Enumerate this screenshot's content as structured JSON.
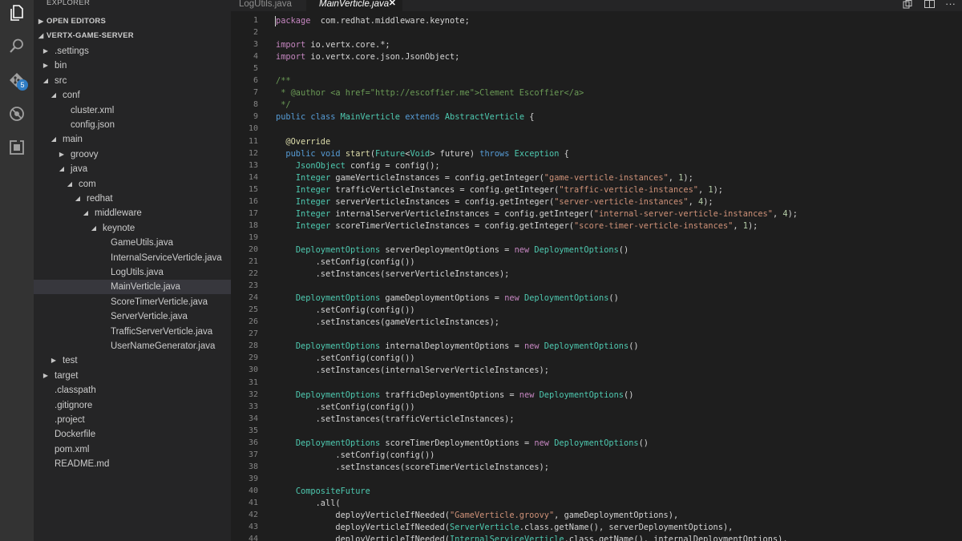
{
  "sidebar": {
    "title": "EXPLORER",
    "open_editors": "OPEN EDITORS",
    "project": "VERTX-GAME-SERVER",
    "tree": [
      {
        "label": ".settings",
        "level": 1,
        "twisty": "collapsed"
      },
      {
        "label": "bin",
        "level": 1,
        "twisty": "collapsed"
      },
      {
        "label": "src",
        "level": 1,
        "twisty": "expanded"
      },
      {
        "label": "conf",
        "level": 2,
        "twisty": "expanded"
      },
      {
        "label": "cluster.xml",
        "level": 3,
        "twisty": "none"
      },
      {
        "label": "config.json",
        "level": 3,
        "twisty": "none"
      },
      {
        "label": "main",
        "level": 2,
        "twisty": "expanded"
      },
      {
        "label": "groovy",
        "level": 3,
        "twisty": "collapsed"
      },
      {
        "label": "java",
        "level": 3,
        "twisty": "expanded"
      },
      {
        "label": "com",
        "level": 4,
        "twisty": "expanded"
      },
      {
        "label": "redhat",
        "level": 5,
        "twisty": "expanded"
      },
      {
        "label": "middleware",
        "level": 6,
        "twisty": "expanded"
      },
      {
        "label": "keynote",
        "level": 7,
        "twisty": "expanded"
      },
      {
        "label": "GameUtils.java",
        "level": 8,
        "twisty": "none"
      },
      {
        "label": "InternalServiceVerticle.java",
        "level": 8,
        "twisty": "none"
      },
      {
        "label": "LogUtils.java",
        "level": 8,
        "twisty": "none"
      },
      {
        "label": "MainVerticle.java",
        "level": 8,
        "twisty": "none",
        "selected": true
      },
      {
        "label": "ScoreTimerVerticle.java",
        "level": 8,
        "twisty": "none"
      },
      {
        "label": "ServerVerticle.java",
        "level": 8,
        "twisty": "none"
      },
      {
        "label": "TrafficServerVerticle.java",
        "level": 8,
        "twisty": "none"
      },
      {
        "label": "UserNameGenerator.java",
        "level": 8,
        "twisty": "none"
      },
      {
        "label": "test",
        "level": 2,
        "twisty": "collapsed"
      },
      {
        "label": "target",
        "level": 1,
        "twisty": "collapsed"
      },
      {
        "label": ".classpath",
        "level": 1,
        "twisty": "none"
      },
      {
        "label": ".gitignore",
        "level": 1,
        "twisty": "none"
      },
      {
        "label": ".project",
        "level": 1,
        "twisty": "none"
      },
      {
        "label": "Dockerfile",
        "level": 1,
        "twisty": "none"
      },
      {
        "label": "pom.xml",
        "level": 1,
        "twisty": "none"
      },
      {
        "label": "README.md",
        "level": 1,
        "twisty": "none"
      }
    ]
  },
  "activity": {
    "items": [
      {
        "name": "explorer-icon"
      },
      {
        "name": "search-icon"
      },
      {
        "name": "source-control-icon",
        "badge": "5"
      },
      {
        "name": "debug-icon"
      },
      {
        "name": "extensions-icon"
      }
    ]
  },
  "tabs": [
    {
      "label": "LogUtils.java",
      "active": false
    },
    {
      "label": "MainVerticle.java",
      "active": true,
      "close": "✕"
    }
  ],
  "toolbar": {
    "split_icon": "split-editor-icon",
    "more": "···"
  },
  "editor": {
    "lines": [
      [
        [
          "kp",
          "package"
        ],
        [
          "",
          "  com.redhat.middleware.keynote;"
        ]
      ],
      [],
      [
        [
          "kp",
          "import"
        ],
        [
          "",
          " io.vertx.core.*;"
        ]
      ],
      [
        [
          "kp",
          "import"
        ],
        [
          "",
          " io.vertx.core.json.JsonObject;"
        ]
      ],
      [],
      [
        [
          "c",
          "/**"
        ]
      ],
      [
        [
          "c",
          " * @author <a href=\"http://escoffier.me\">Clement Escoffier</a>"
        ]
      ],
      [
        [
          "c",
          " */"
        ]
      ],
      [
        [
          "k",
          "public"
        ],
        [
          "",
          " "
        ],
        [
          "k",
          "class"
        ],
        [
          "",
          " "
        ],
        [
          "t",
          "MainVerticle"
        ],
        [
          "",
          " "
        ],
        [
          "k",
          "extends"
        ],
        [
          "",
          " "
        ],
        [
          "t",
          "AbstractVerticle"
        ],
        [
          "",
          " {"
        ]
      ],
      [],
      [
        [
          "",
          "  "
        ],
        [
          "a",
          "@Override"
        ]
      ],
      [
        [
          "",
          "  "
        ],
        [
          "k",
          "public"
        ],
        [
          "",
          " "
        ],
        [
          "k",
          "void"
        ],
        [
          "",
          " "
        ],
        [
          "a",
          "start"
        ],
        [
          "",
          "("
        ],
        [
          "t",
          "Future"
        ],
        [
          "",
          "<"
        ],
        [
          "t",
          "Void"
        ],
        [
          "",
          "> future) "
        ],
        [
          "k",
          "throws"
        ],
        [
          "",
          " "
        ],
        [
          "t",
          "Exception"
        ],
        [
          "",
          " {"
        ]
      ],
      [
        [
          "",
          "    "
        ],
        [
          "t",
          "JsonObject"
        ],
        [
          "",
          " config = config();"
        ]
      ],
      [
        [
          "",
          "    "
        ],
        [
          "t",
          "Integer"
        ],
        [
          "",
          " gameVerticleInstances = config.getInteger("
        ],
        [
          "s",
          "\"game-verticle-instances\""
        ],
        [
          "",
          ", "
        ],
        [
          "n",
          "1"
        ],
        [
          "",
          ");"
        ]
      ],
      [
        [
          "",
          "    "
        ],
        [
          "t",
          "Integer"
        ],
        [
          "",
          " trafficVerticleInstances = config.getInteger("
        ],
        [
          "s",
          "\"traffic-verticle-instances\""
        ],
        [
          "",
          ", "
        ],
        [
          "n",
          "1"
        ],
        [
          "",
          ");"
        ]
      ],
      [
        [
          "",
          "    "
        ],
        [
          "t",
          "Integer"
        ],
        [
          "",
          " serverVerticleInstances = config.getInteger("
        ],
        [
          "s",
          "\"server-verticle-instances\""
        ],
        [
          "",
          ", "
        ],
        [
          "n",
          "4"
        ],
        [
          "",
          ");"
        ]
      ],
      [
        [
          "",
          "    "
        ],
        [
          "t",
          "Integer"
        ],
        [
          "",
          " internalServerVerticleInstances = config.getInteger("
        ],
        [
          "s",
          "\"internal-server-verticle-instances\""
        ],
        [
          "",
          ", "
        ],
        [
          "n",
          "4"
        ],
        [
          "",
          ");"
        ]
      ],
      [
        [
          "",
          "    "
        ],
        [
          "t",
          "Integer"
        ],
        [
          "",
          " scoreTimerVerticleInstances = config.getInteger("
        ],
        [
          "s",
          "\"score-timer-verticle-instances\""
        ],
        [
          "",
          ", "
        ],
        [
          "n",
          "1"
        ],
        [
          "",
          ");"
        ]
      ],
      [],
      [
        [
          "",
          "    "
        ],
        [
          "t",
          "DeploymentOptions"
        ],
        [
          "",
          " serverDeploymentOptions = "
        ],
        [
          "kp",
          "new"
        ],
        [
          "",
          " "
        ],
        [
          "t",
          "DeploymentOptions"
        ],
        [
          "",
          "()"
        ]
      ],
      [
        [
          "",
          "        .setConfig(config())"
        ]
      ],
      [
        [
          "",
          "        .setInstances(serverVerticleInstances);"
        ]
      ],
      [],
      [
        [
          "",
          "    "
        ],
        [
          "t",
          "DeploymentOptions"
        ],
        [
          "",
          " gameDeploymentOptions = "
        ],
        [
          "kp",
          "new"
        ],
        [
          "",
          " "
        ],
        [
          "t",
          "DeploymentOptions"
        ],
        [
          "",
          "()"
        ]
      ],
      [
        [
          "",
          "        .setConfig(config())"
        ]
      ],
      [
        [
          "",
          "        .setInstances(gameVerticleInstances);"
        ]
      ],
      [],
      [
        [
          "",
          "    "
        ],
        [
          "t",
          "DeploymentOptions"
        ],
        [
          "",
          " internalDeploymentOptions = "
        ],
        [
          "kp",
          "new"
        ],
        [
          "",
          " "
        ],
        [
          "t",
          "DeploymentOptions"
        ],
        [
          "",
          "()"
        ]
      ],
      [
        [
          "",
          "        .setConfig(config())"
        ]
      ],
      [
        [
          "",
          "        .setInstances(internalServerVerticleInstances);"
        ]
      ],
      [],
      [
        [
          "",
          "    "
        ],
        [
          "t",
          "DeploymentOptions"
        ],
        [
          "",
          " trafficDeploymentOptions = "
        ],
        [
          "kp",
          "new"
        ],
        [
          "",
          " "
        ],
        [
          "t",
          "DeploymentOptions"
        ],
        [
          "",
          "()"
        ]
      ],
      [
        [
          "",
          "        .setConfig(config())"
        ]
      ],
      [
        [
          "",
          "        .setInstances(trafficVerticleInstances);"
        ]
      ],
      [],
      [
        [
          "",
          "    "
        ],
        [
          "t",
          "DeploymentOptions"
        ],
        [
          "",
          " scoreTimerDeploymentOptions = "
        ],
        [
          "kp",
          "new"
        ],
        [
          "",
          " "
        ],
        [
          "t",
          "DeploymentOptions"
        ],
        [
          "",
          "()"
        ]
      ],
      [
        [
          "",
          "            .setConfig(config())"
        ]
      ],
      [
        [
          "",
          "            .setInstances(scoreTimerVerticleInstances);"
        ]
      ],
      [],
      [
        [
          "",
          "    "
        ],
        [
          "t",
          "CompositeFuture"
        ]
      ],
      [
        [
          "",
          "        .all("
        ]
      ],
      [
        [
          "",
          "            deployVerticleIfNeeded("
        ],
        [
          "s",
          "\"GameVerticle.groovy\""
        ],
        [
          "",
          ", gameDeploymentOptions),"
        ]
      ],
      [
        [
          "",
          "            deployVerticleIfNeeded("
        ],
        [
          "t",
          "ServerVerticle"
        ],
        [
          "",
          ".class.getName(), serverDeploymentOptions),"
        ]
      ],
      [
        [
          "",
          "            deployVerticleIfNeeded("
        ],
        [
          "t",
          "InternalServiceVerticle"
        ],
        [
          "",
          ".class.getName(), internalDeploymentOptions),"
        ]
      ]
    ]
  }
}
